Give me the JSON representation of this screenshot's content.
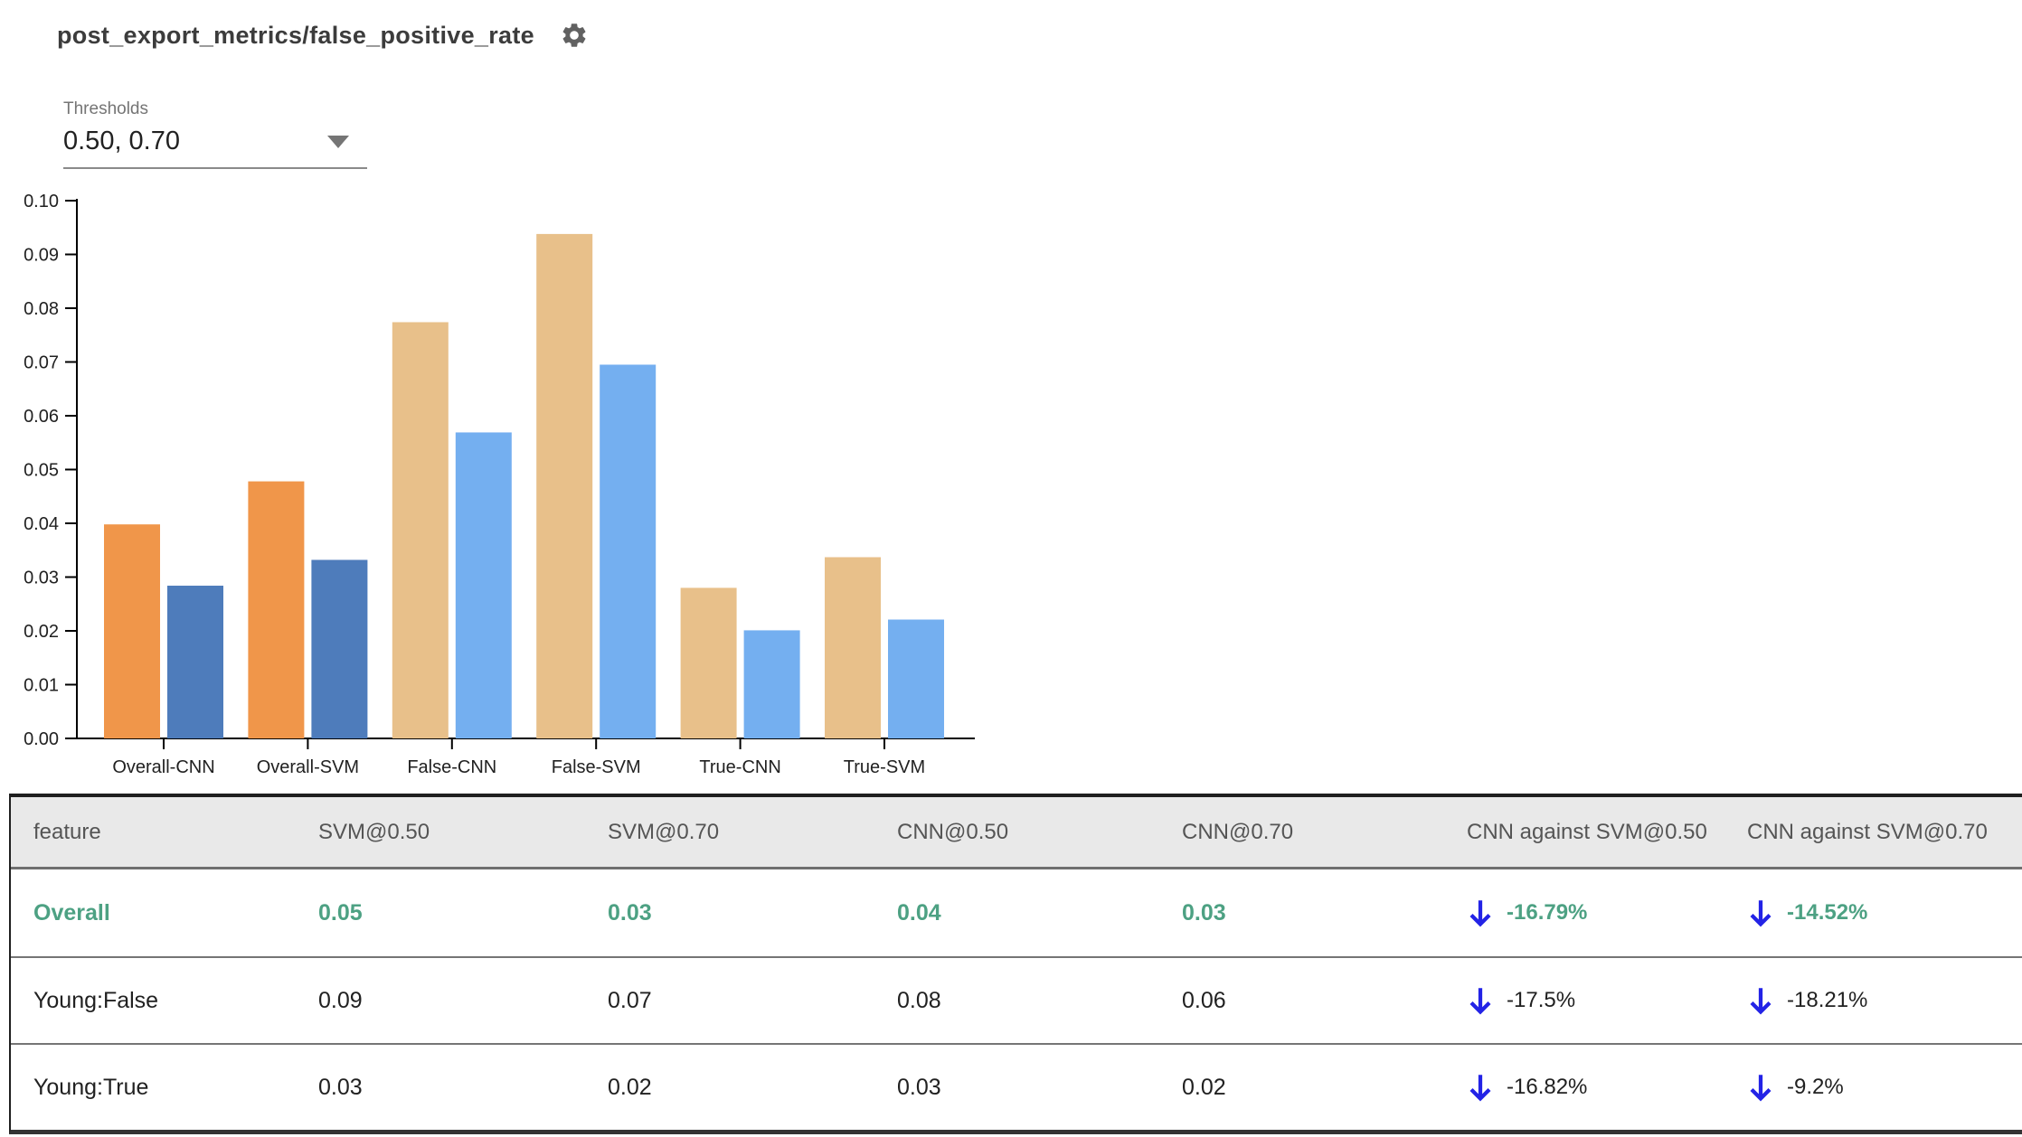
{
  "header": {
    "title": "post_export_metrics/false_positive_rate"
  },
  "thresholds": {
    "label": "Thresholds",
    "value": "0.50, 0.70"
  },
  "chart_data": {
    "type": "bar",
    "categories": [
      "Overall-CNN",
      "Overall-SVM",
      "False-CNN",
      "False-SVM",
      "True-CNN",
      "True-SVM"
    ],
    "series": [
      {
        "name": "0.50",
        "values": [
          0.0398,
          0.0478,
          0.0774,
          0.0938,
          0.028,
          0.0337
        ]
      },
      {
        "name": "0.70",
        "values": [
          0.0284,
          0.0332,
          0.0569,
          0.0695,
          0.0201,
          0.0221
        ]
      }
    ],
    "highlight_prefix": "Overall",
    "colors": {
      "highlight": [
        "#f0964a",
        "#4e7cbb"
      ],
      "slice": [
        "#e8c08a",
        "#74aff0"
      ]
    },
    "ylim": [
      0,
      0.1
    ],
    "ytick_labels": [
      "0.00",
      "0.01",
      "0.02",
      "0.03",
      "0.04",
      "0.05",
      "0.06",
      "0.07",
      "0.08",
      "0.09",
      "0.10"
    ],
    "xlabel": "",
    "ylabel": "",
    "grid": false,
    "legend": "none"
  },
  "table": {
    "columns": [
      "feature",
      "SVM@0.50",
      "SVM@0.70",
      "CNN@0.50",
      "CNN@0.70",
      "CNN against SVM@0.50",
      "CNN against SVM@0.70"
    ],
    "rows": [
      {
        "feature": "Overall",
        "values": [
          "0.05",
          "0.03",
          "0.04",
          "0.03"
        ],
        "deltas": [
          "-16.79%",
          "-14.52%"
        ],
        "highlighted": true
      },
      {
        "feature": "Young:False",
        "values": [
          "0.09",
          "0.07",
          "0.08",
          "0.06"
        ],
        "deltas": [
          "-17.5%",
          "-18.21%"
        ],
        "highlighted": false
      },
      {
        "feature": "Young:True",
        "values": [
          "0.03",
          "0.02",
          "0.03",
          "0.02"
        ],
        "deltas": [
          "-16.82%",
          "-9.2%"
        ],
        "highlighted": false
      }
    ],
    "colors": {
      "highlight_text": "#4da183",
      "delta_arrow": "#2323e6",
      "header_bg": "#e9e9e9",
      "header_text": "#555555",
      "body_text": "#212121"
    }
  }
}
